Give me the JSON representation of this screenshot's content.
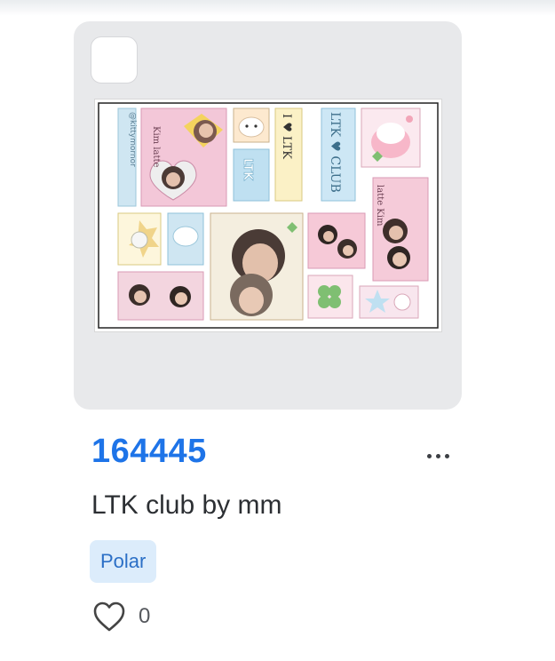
{
  "item": {
    "code": "164445",
    "title": "LTK club by mm",
    "tag": "Polar",
    "like_count": "0",
    "selected": false
  },
  "sheet_text": {
    "handle": "@kittymornor",
    "kim_latte_1": "Kim latte",
    "i_ltk": "I ♥ LTK",
    "ltk_club": "LTK ♥ CLUB",
    "latte_kim_2": "latte Kim",
    "ltk_logo": "LTK"
  },
  "colors": {
    "accent": "#1e74e8",
    "tag_bg": "#dcecfb",
    "tag_text": "#2b6fc6",
    "card_bg": "#e8e9eb"
  },
  "icons": {
    "more": "more-dots-icon",
    "like": "heart-outline-icon"
  }
}
